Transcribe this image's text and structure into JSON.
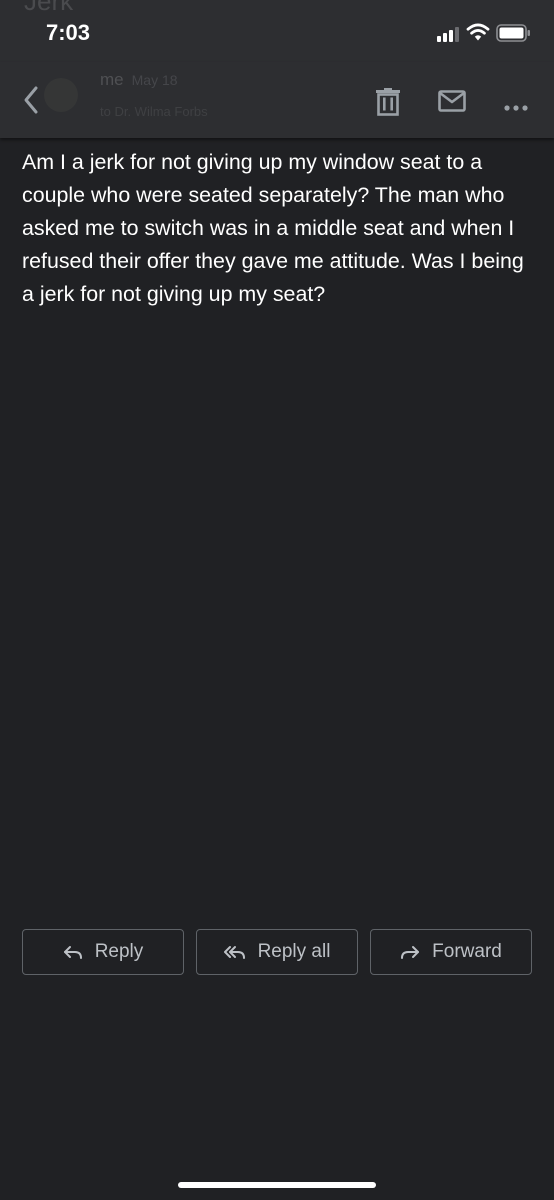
{
  "status_bar": {
    "time": "7:03",
    "ghost_subject": "Jerk"
  },
  "email": {
    "sender": "me",
    "date": "May 18",
    "recipient_line": "to Dr. Wilma Forbs",
    "body": "Am I a jerk for not giving up my window seat to a couple who were seated separately? The man who asked me to switch was in a middle seat and when I refused their offer they gave me attitude. Was I being a jerk for not giving up my seat?"
  },
  "icons": {
    "back": "chevron-left-icon",
    "delete": "trash-icon",
    "mark_unread": "mail-icon",
    "more": "more-horizontal-icon",
    "reply": "reply-icon",
    "reply_all": "reply-all-icon",
    "forward": "forward-icon"
  },
  "actions": {
    "reply_label": "Reply",
    "reply_all_label": "Reply all",
    "forward_label": "Forward"
  },
  "colors": {
    "background": "#202124",
    "toolbar": "#2d2e31",
    "text": "#ffffff",
    "button_border": "#5f6368",
    "button_text": "#bdc1c6"
  }
}
